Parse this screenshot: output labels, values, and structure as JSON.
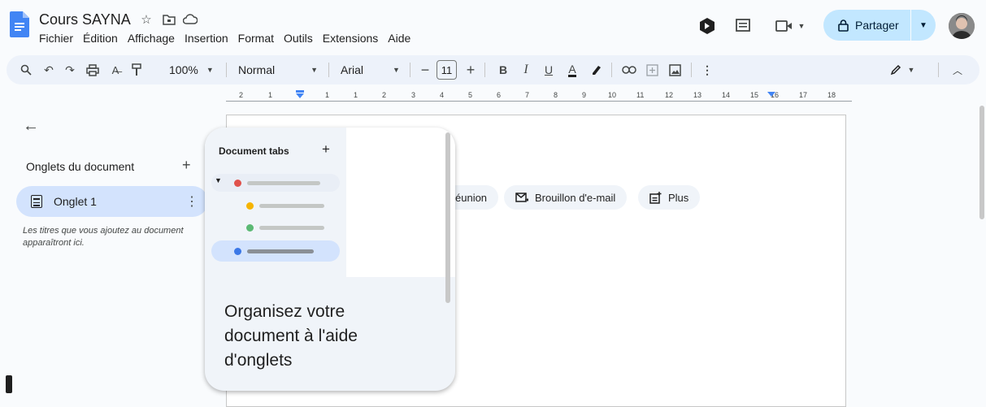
{
  "header": {
    "title": "Cours SAYNA",
    "menu": [
      "Fichier",
      "Édition",
      "Affichage",
      "Insertion",
      "Format",
      "Outils",
      "Extensions",
      "Aide"
    ],
    "share_label": "Partager"
  },
  "toolbar": {
    "zoom": "100%",
    "style": "Normal",
    "font": "Arial",
    "font_size": "11",
    "bold": "B",
    "italic": "I",
    "underline": "U",
    "text_color": "A",
    "more": "⋮"
  },
  "ruler": {
    "ticks": [
      "2",
      "1",
      "1",
      "1",
      "2",
      "3",
      "4",
      "5",
      "6",
      "7",
      "8",
      "9",
      "10",
      "11",
      "12",
      "13",
      "14",
      "15",
      "16",
      "17",
      "18"
    ]
  },
  "sidebar": {
    "heading": "Onglets du document",
    "tab_label": "Onglet 1",
    "hint": "Les titres que vous ajoutez au document apparaîtront ici."
  },
  "chips": {
    "meeting": "éunion",
    "email": "Brouillon d'e-mail",
    "more": "Plus"
  },
  "popup": {
    "illus_title": "Document tabs",
    "heading": "Organisez votre document à l'aide d'onglets"
  },
  "colors": {
    "accent": "#c2e7ff",
    "tab_selected": "#d3e3fd",
    "dot_red": "#e0524c",
    "dot_yellow": "#f6b400",
    "dot_green": "#5bb974",
    "dot_blue": "#3b78e7"
  }
}
